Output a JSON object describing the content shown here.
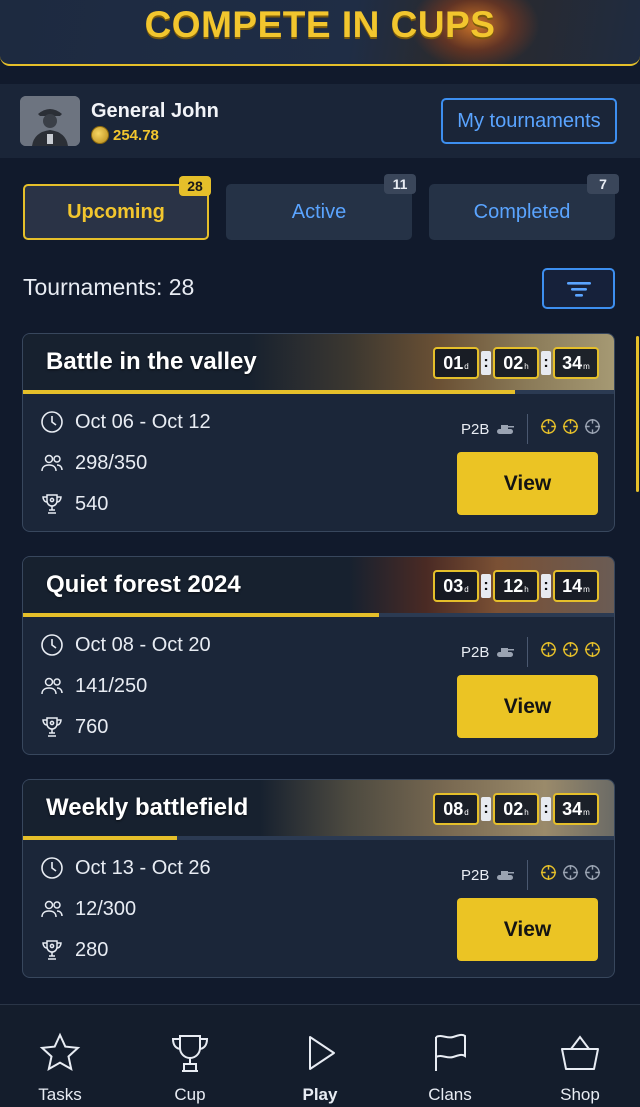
{
  "header": {
    "title": "COMPETE IN CUPS"
  },
  "profile": {
    "name": "General John",
    "coins": "254.78",
    "my_tournaments_label": "My tournaments"
  },
  "tabs": [
    {
      "label": "Upcoming",
      "badge": "28",
      "active": true
    },
    {
      "label": "Active",
      "badge": "11",
      "active": false
    },
    {
      "label": "Completed",
      "badge": "7",
      "active": false
    }
  ],
  "list": {
    "count_label": "Tournaments: 28"
  },
  "tournaments": [
    {
      "title": "Battle in the valley",
      "timer": {
        "days": "01",
        "hours": "02",
        "minutes": "34",
        "d_unit": "d",
        "h_unit": "h",
        "m_unit": "m"
      },
      "dates": "Oct 06 - Oct 12",
      "players": "298/350",
      "prize": "540",
      "mode": "P2B",
      "progress": 0.83,
      "difficulty": 2,
      "view_label": "View"
    },
    {
      "title": "Quiet forest 2024",
      "timer": {
        "days": "03",
        "hours": "12",
        "minutes": "14",
        "d_unit": "d",
        "h_unit": "h",
        "m_unit": "m"
      },
      "dates": "Oct 08 - Oct 20",
      "players": "141/250",
      "prize": "760",
      "mode": "P2B",
      "progress": 0.6,
      "difficulty": 3,
      "view_label": "View"
    },
    {
      "title": "Weekly battlefield",
      "timer": {
        "days": "08",
        "hours": "02",
        "minutes": "34",
        "d_unit": "d",
        "h_unit": "h",
        "m_unit": "m"
      },
      "dates": "Oct 13 - Oct 26",
      "players": "12/300",
      "prize": "280",
      "mode": "P2B",
      "progress": 0.26,
      "difficulty": 1,
      "view_label": "View"
    }
  ],
  "bottom_nav": [
    {
      "label": "Tasks",
      "icon": "star-icon"
    },
    {
      "label": "Cup",
      "icon": "trophy-icon"
    },
    {
      "label": "Play",
      "icon": "play-icon",
      "current": true
    },
    {
      "label": "Clans",
      "icon": "flag-icon"
    },
    {
      "label": "Shop",
      "icon": "basket-icon"
    }
  ],
  "colors": {
    "accent": "#e5bf2a",
    "link": "#3d8ff0",
    "background": "#111a2c"
  }
}
